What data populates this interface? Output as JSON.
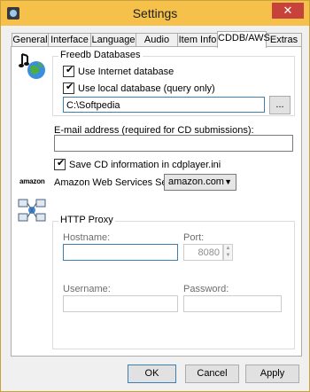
{
  "window": {
    "title": "Settings",
    "close_glyph": "✕"
  },
  "tabs": [
    {
      "label": "General"
    },
    {
      "label": "Interface"
    },
    {
      "label": "Language"
    },
    {
      "label": "Audio CD"
    },
    {
      "label": "Item Info"
    },
    {
      "label": "CDDB/AWS",
      "active": true
    },
    {
      "label": "Extras"
    }
  ],
  "freedb": {
    "title": "Freedb Databases",
    "use_internet_label": "Use Internet database",
    "use_internet_checked": true,
    "use_local_label": "Use local database (query only)",
    "use_local_checked": true,
    "local_path": "C:\\Softpedia",
    "browse_label": "..."
  },
  "email": {
    "label": "E-mail address (required for CD submissions):",
    "value": ""
  },
  "save_cd_info": {
    "label": "Save CD information in cdplayer.ini",
    "checked": true
  },
  "aws": {
    "logo_text": "amazon",
    "label": "Amazon Web Services Server:",
    "selected": "amazon.com"
  },
  "proxy": {
    "title": "HTTP Proxy",
    "hostname_label": "Hostname:",
    "hostname_value": "",
    "port_label": "Port:",
    "port_value": "8080",
    "username_label": "Username:",
    "username_value": "",
    "password_label": "Password:",
    "password_value": ""
  },
  "buttons": {
    "ok": "OK",
    "cancel": "Cancel",
    "apply": "Apply"
  },
  "check_glyph": "✔"
}
